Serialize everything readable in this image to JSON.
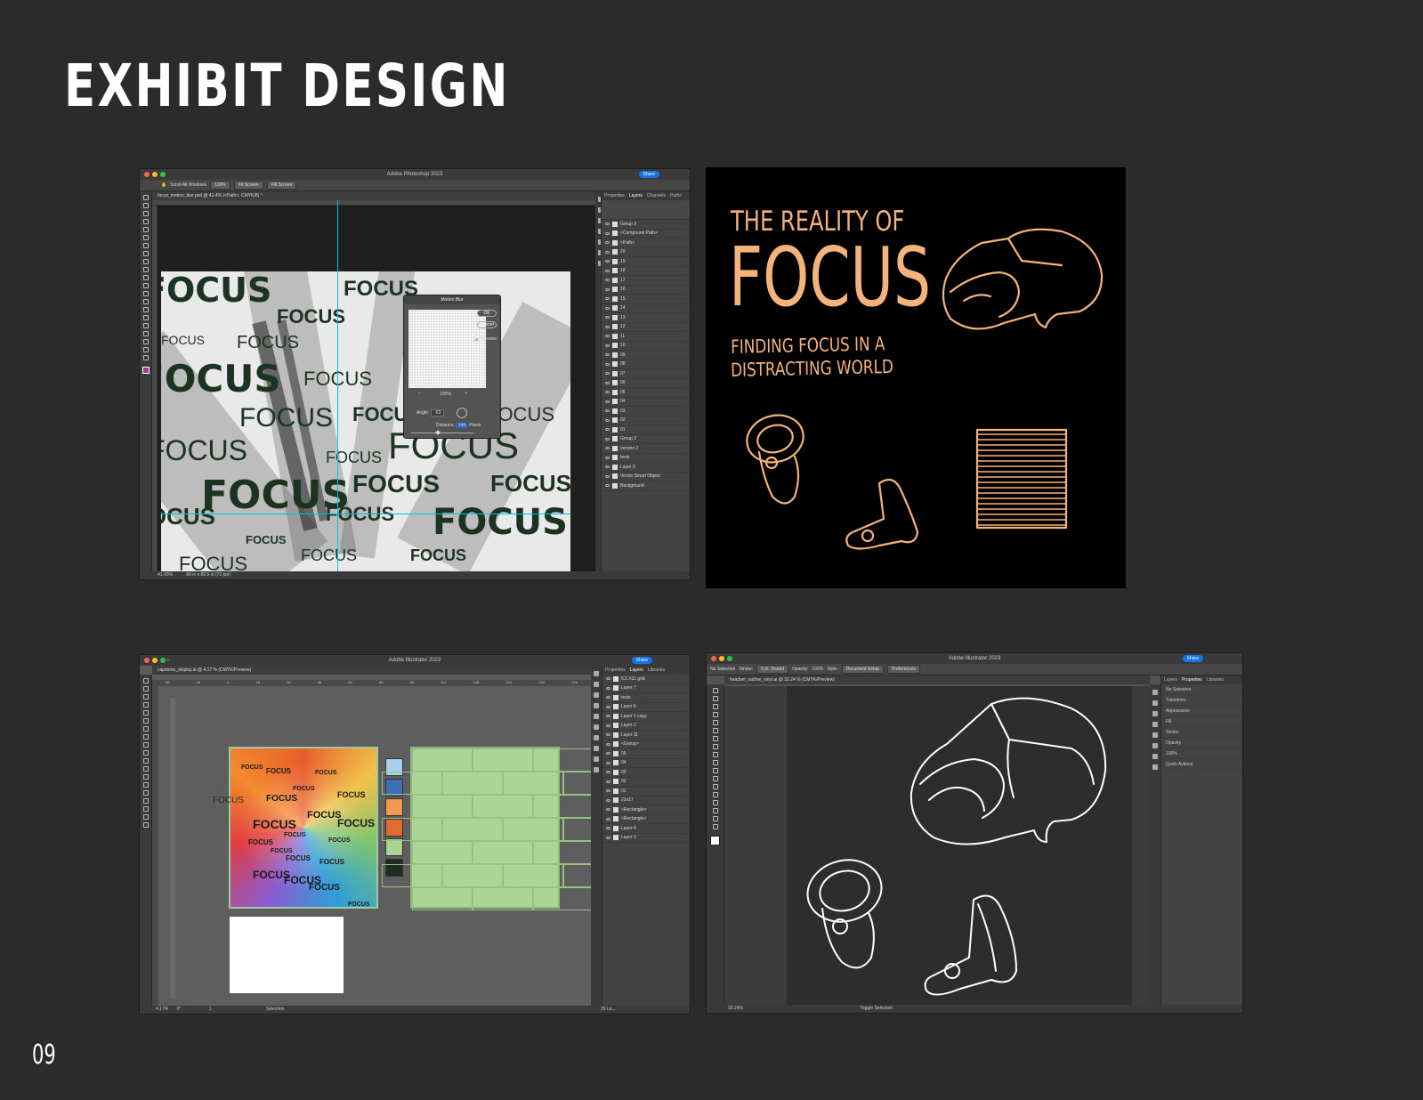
{
  "page": {
    "title": "EXHIBIT DESIGN",
    "number": "09"
  },
  "photoshop": {
    "window_title": "Adobe Photoshop 2023",
    "doc_tab": "focus_motion_blur.psd @ 41.4% (<Path>, CMYK/8) *",
    "options": [
      "Scroll All Windows",
      "100%",
      "Fit Screen",
      "Fill Screen"
    ],
    "share": "Share",
    "panel_tabs": [
      "Properties",
      "Layers",
      "Channels",
      "Paths"
    ],
    "layers": [
      "Group 3",
      "<Compound Path>",
      "<Path>",
      "20",
      "19",
      "18",
      "17",
      "16",
      "15",
      "14",
      "13",
      "12",
      "11",
      "10",
      "09",
      "08",
      "07",
      "06",
      "05",
      "04",
      "03",
      "02",
      "01",
      "Group 2",
      "version 2",
      "texts",
      "Layer 0",
      "Vector Smart Object",
      "Background"
    ],
    "status": "41.43%",
    "status_doc": "80 in x 80.5 in (72 ppi)",
    "art_word": "FOCUS",
    "dialog": {
      "title": "Motion Blur",
      "ok": "OK",
      "cancel": "Cancel",
      "preview": "Preview",
      "zoom": "100%",
      "angle_label": "Angle:",
      "angle_value": "-83",
      "distance_label": "Distance:",
      "distance_value": "144",
      "distance_unit": "Pixels"
    }
  },
  "sketch": {
    "title_line1": "THE REALITY OF",
    "title_line2": "FOCUS",
    "subtitle_line1": "FINDING FOCUS IN A",
    "subtitle_line2": "DISTRACTING WORLD"
  },
  "illustrator1": {
    "window_title": "Adobe Illustrator 2023",
    "doc_tab": "capstone_display.ai @ 4.17 % (CMYK/Preview)",
    "share": "Share",
    "panel_tabs": [
      "Properties",
      "Layers",
      "Libraries"
    ],
    "layers": [
      "5.5 X11 grid",
      "Layer 7",
      "texts",
      "Layer 6",
      "Layer 1 copy",
      "Layer 2",
      "Layer 11",
      "<Group>",
      "05",
      "04",
      "03",
      "02",
      "01",
      "21x17",
      "<Rectangle>",
      "<Rectangle>",
      "Layer 4",
      "Layer 3"
    ],
    "ruler_ticks": [
      "32",
      "16",
      "0",
      "16",
      "32",
      "48",
      "64",
      "80",
      "96",
      "112",
      "128",
      "144",
      "160",
      "176"
    ],
    "status_zoom": "4.17%",
    "status_angle": "0°",
    "status_page": "1",
    "status_tool": "Selection",
    "status_layers": "20 La..."
  },
  "illustrator2": {
    "window_title": "Adobe Illustrator 2023",
    "doc_tab": "headset_outline_vinyl.ai @ 32.24 % (CMYK/Preview)",
    "share": "Share",
    "toolbar_labels": [
      "No Selection",
      "Stroke:",
      "5 pt. Round",
      "Opacity:",
      "100%",
      "Style:",
      "Document Setup",
      "Preferences"
    ],
    "panel_tabs": [
      "Layers",
      "Properties",
      "Libraries"
    ],
    "properties": [
      "No Selection",
      "Transform",
      "Appearance",
      "Fill",
      "Stroke",
      "Opacity",
      "100%",
      "Quick Actions"
    ],
    "status_zoom": "32.24%",
    "status_tool": "Toggle Selection"
  },
  "colors": {
    "background": "#2b2b2b",
    "sketch_orange": "#f4b37a",
    "ps_dark_green": "#1d3321",
    "guide_cyan": "#00c2d9",
    "swatches": [
      "#a9cfee",
      "#3e6fb9",
      "#f39a4e",
      "#e56a2e",
      "#a8d493",
      "#1e2d22"
    ]
  }
}
